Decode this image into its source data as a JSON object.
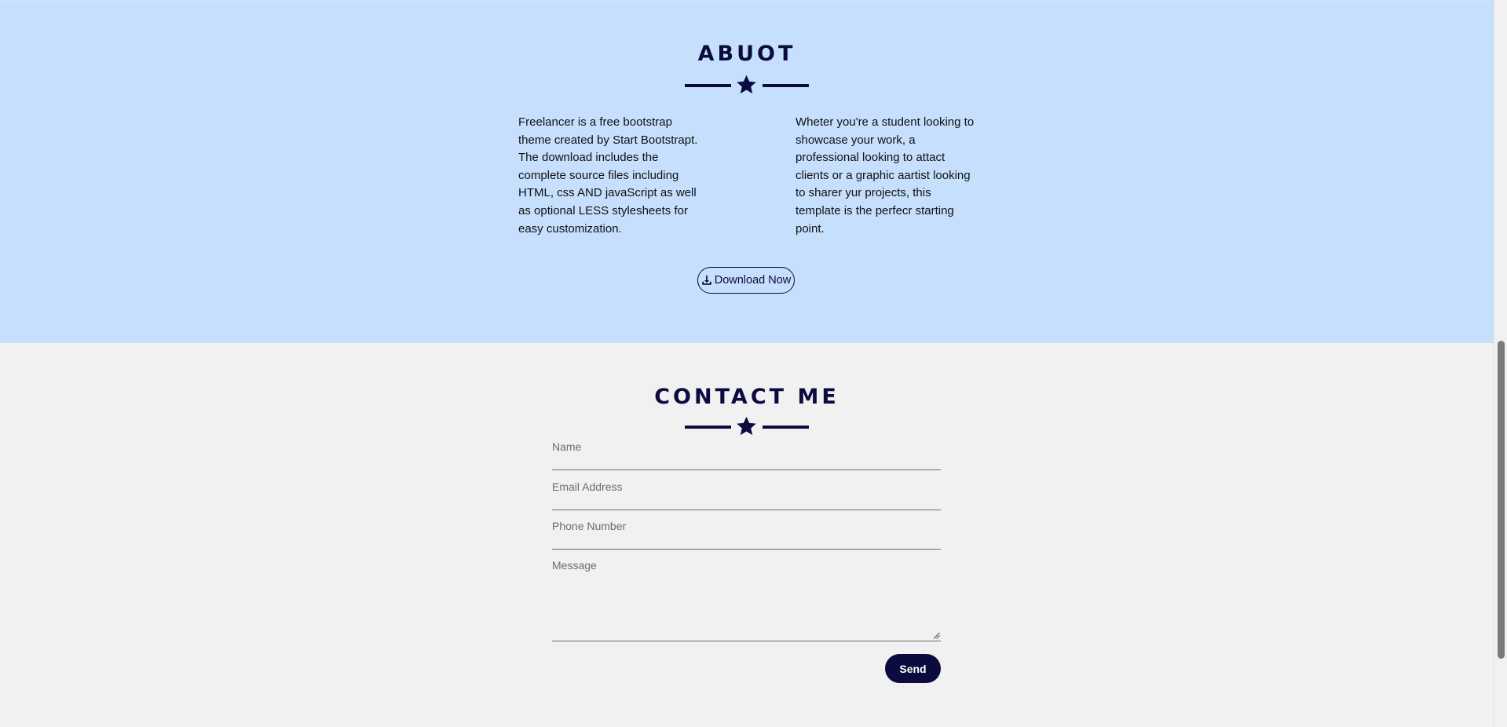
{
  "about": {
    "title": "ABUOT",
    "left_paragraph": "Freelancer is a free bootstrap theme created by Start Bootstrapt. The download includes the complete source files including HTML, css AND javaScript as well as optional LESS stylesheets for easy customization.",
    "right_paragraph": "Wheter you're a student looking to showcase your work, a professional looking to attact clients or a graphic aartist looking to sharer yur projects, this template is the perfecr starting point.",
    "download_label": "Download Now",
    "download_icon": "download-icon",
    "divider_icon": "star-icon"
  },
  "contact": {
    "title": "CONTACT ME",
    "divider_icon": "star-icon",
    "fields": {
      "name_placeholder": "Name",
      "email_placeholder": "Email Address",
      "phone_placeholder": "Phone Number",
      "message_placeholder": "Message"
    },
    "send_label": "Send"
  },
  "colors": {
    "navy": "#0c0b3f",
    "about_bg": "#c5dffd",
    "contact_bg": "#f1f1f1"
  }
}
